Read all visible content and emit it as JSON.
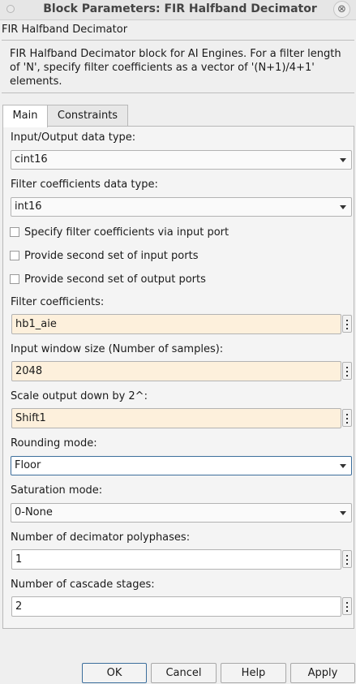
{
  "window": {
    "title": "Block Parameters: FIR Halfband Decimator",
    "close_glyph": "⊗"
  },
  "block": {
    "name": "FIR Halfband Decimator",
    "description": "FIR Halfband Decimator block for AI Engines. For a filter length of 'N', specify filter coefficients as a vector of '(N+1)/4+1' elements."
  },
  "tabs": [
    {
      "label": "Main",
      "selected": true
    },
    {
      "label": "Constraints",
      "selected": false
    }
  ],
  "params": {
    "io_type": {
      "label": "Input/Output data type:",
      "value": "cint16"
    },
    "coef_type": {
      "label": "Filter coefficients data type:",
      "value": "int16"
    },
    "checkboxes": [
      {
        "label": "Specify filter coefficients via input port",
        "checked": false
      },
      {
        "label": "Provide second set of input ports",
        "checked": false
      },
      {
        "label": "Provide second set of output ports",
        "checked": false
      }
    ],
    "filter_coeffs": {
      "label": "Filter coefficients:",
      "value": "hb1_aie"
    },
    "window_size": {
      "label": "Input window size (Number of samples):",
      "value": "2048"
    },
    "scale_output": {
      "label": "Scale output down by 2^:",
      "value": "Shift1"
    },
    "rounding": {
      "label": "Rounding mode:",
      "value": "Floor"
    },
    "saturation": {
      "label": "Saturation mode:",
      "value": "0-None"
    },
    "polyphases": {
      "label": "Number of decimator polyphases:",
      "value": "1"
    },
    "cascade": {
      "label": "Number of cascade stages:",
      "value": "2"
    }
  },
  "buttons": {
    "ok": "OK",
    "cancel": "Cancel",
    "help": "Help",
    "apply": "Apply"
  },
  "colors": {
    "tinted_field": "#fdf0dc",
    "focus_border": "#3c6e9c"
  }
}
